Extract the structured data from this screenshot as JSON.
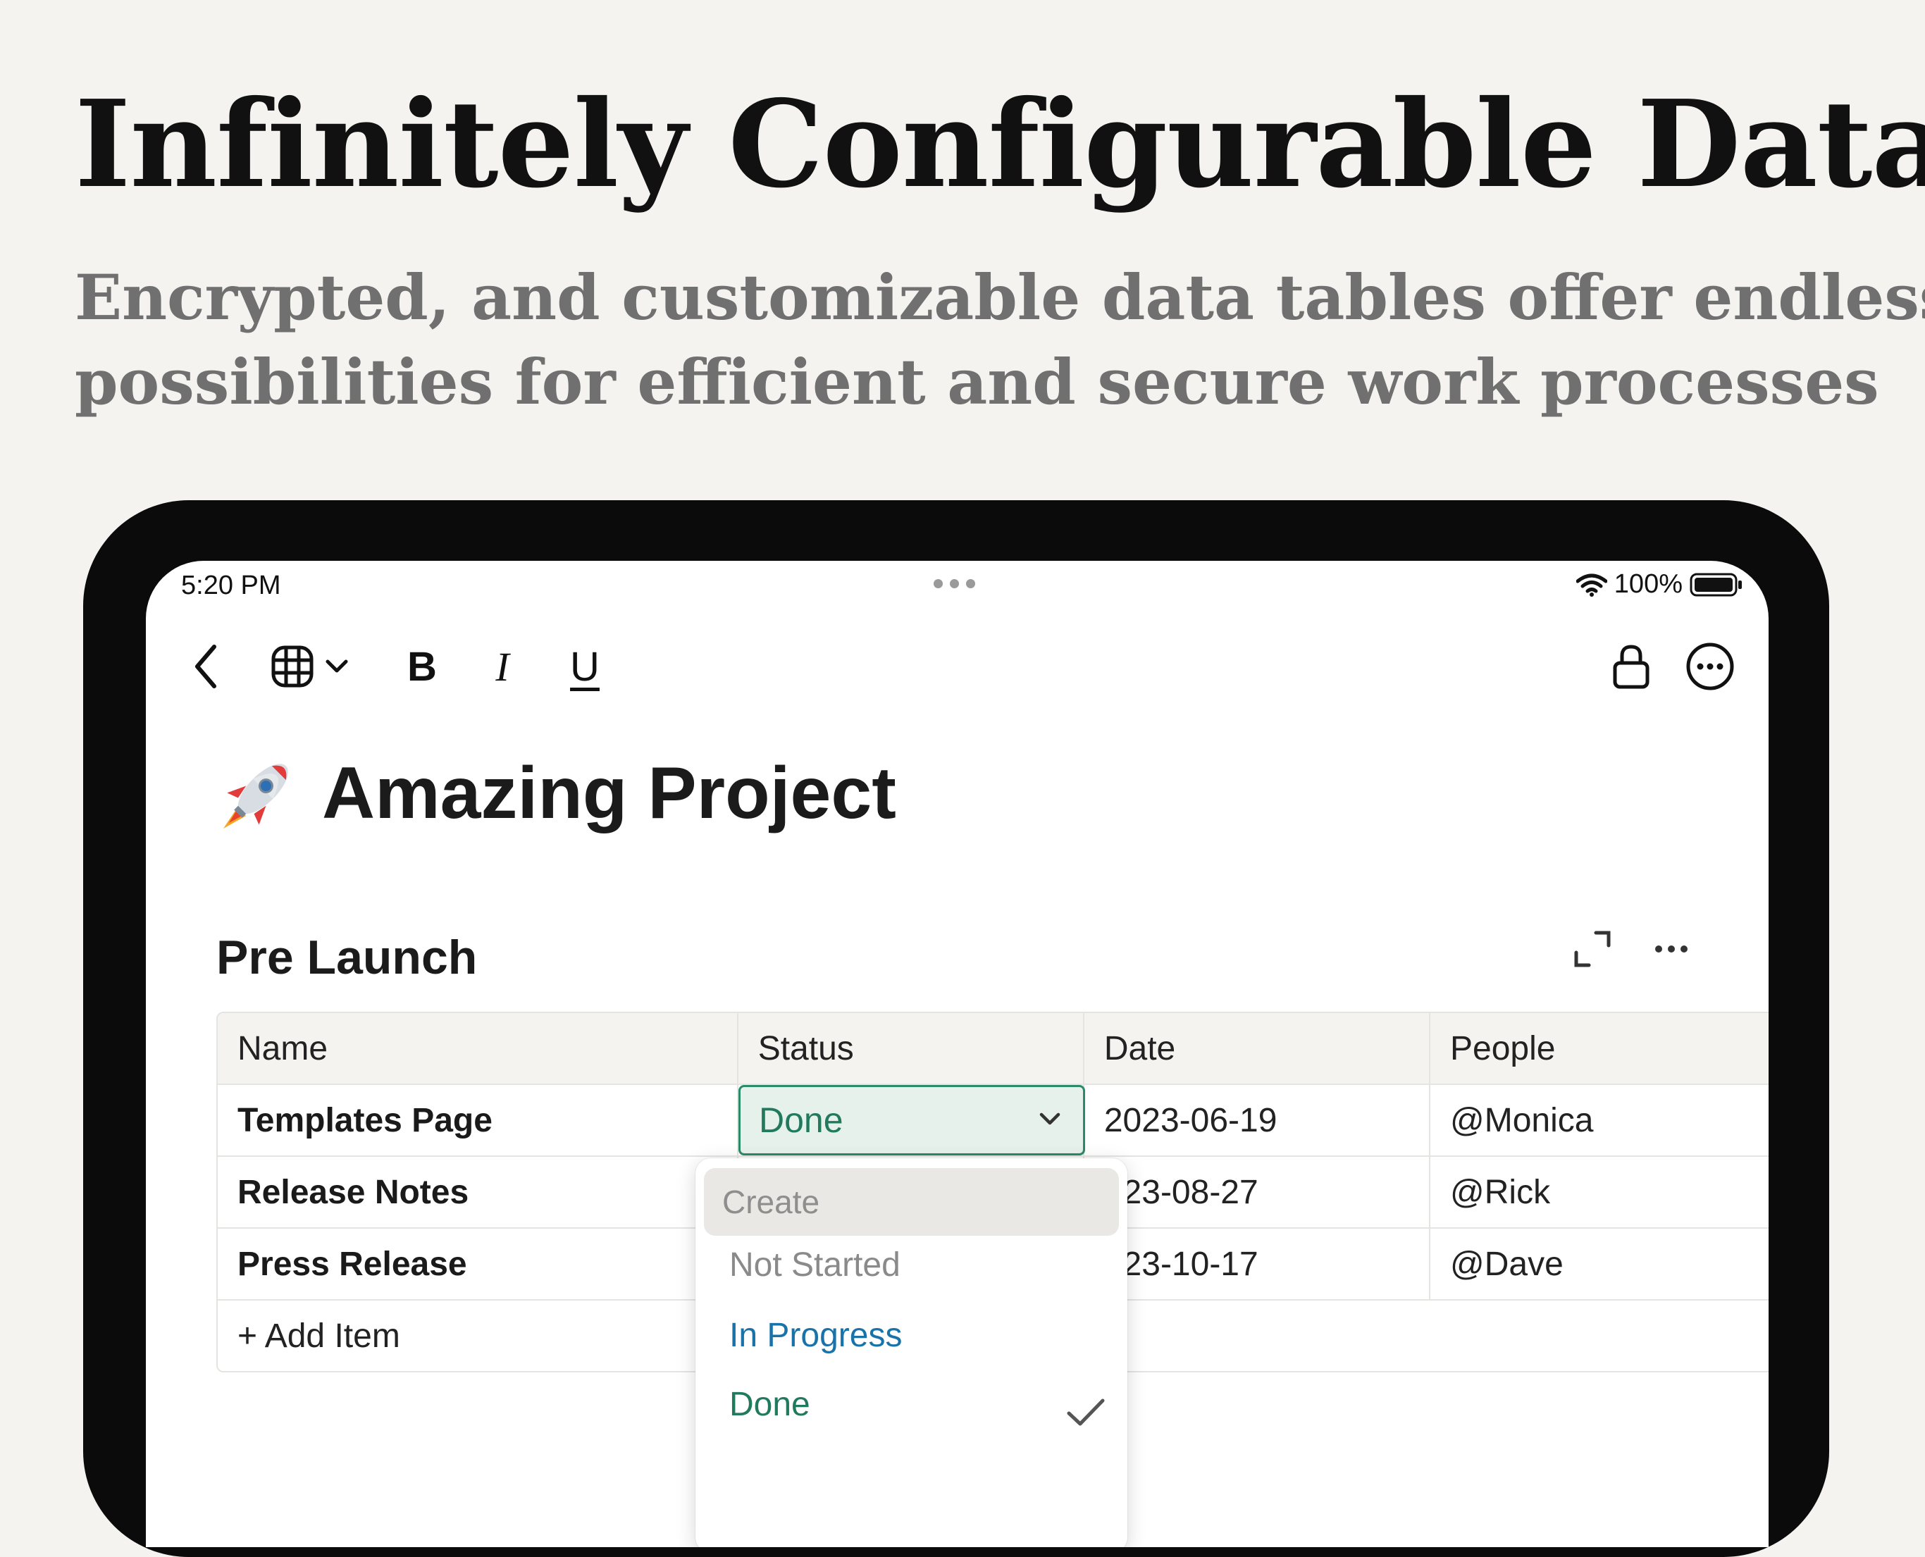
{
  "headline": "Infinitely Configurable Data",
  "subheadline": [
    "Encrypted, and customizable data tables offer endless",
    "possibilities for efficient and secure work processes"
  ],
  "status_bar": {
    "time": "5:20 PM",
    "battery": "100%"
  },
  "toolbar": {
    "bold_label": "B",
    "italic_label": "I",
    "underline_label": "U"
  },
  "page": {
    "emoji": "rocket",
    "title": "Amazing Project"
  },
  "section": {
    "title": "Pre Launch"
  },
  "table": {
    "columns": [
      "Name",
      "Status",
      "Date",
      "People"
    ],
    "rows": [
      {
        "name": "Templates Page",
        "status": "Done",
        "date": "2023-06-19",
        "people": "@Monica"
      },
      {
        "name": "Release Notes",
        "status": "",
        "date": "023-08-27",
        "people": "@Rick"
      },
      {
        "name": "Press Release",
        "status": "",
        "date": "023-10-17",
        "people": "@Dave"
      }
    ],
    "add_item": "+ Add Item"
  },
  "status_dropdown": {
    "create_placeholder": "Create",
    "options": [
      {
        "label": "Not Started",
        "color": "#8a8a8a",
        "selected": false
      },
      {
        "label": "In Progress",
        "color": "#1a73a8",
        "selected": false
      },
      {
        "label": "Done",
        "color": "#217a5e",
        "selected": true
      }
    ]
  },
  "colors": {
    "background": "#f4f3f0",
    "device_bezel": "#0b0b0c",
    "done_green": "#217a5e",
    "in_progress_blue": "#1a73a8",
    "subheadline_gray": "#707070"
  }
}
